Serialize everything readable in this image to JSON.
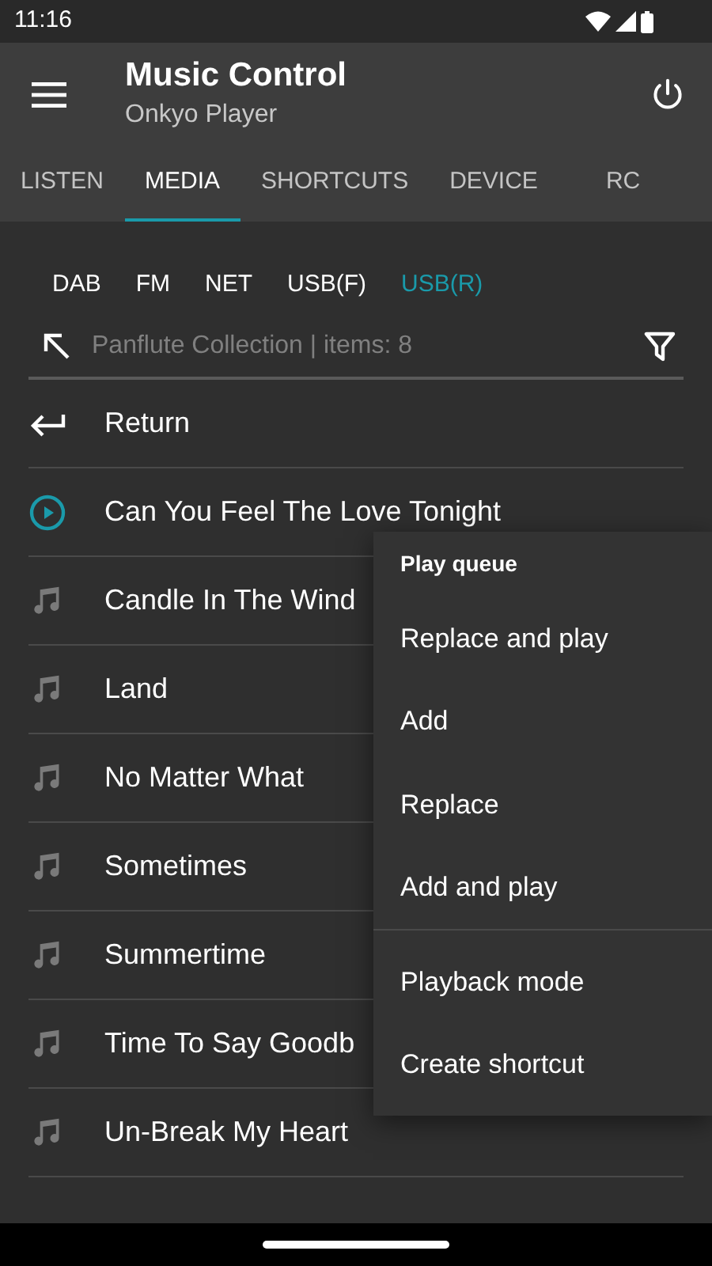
{
  "status_bar": {
    "time": "11:16"
  },
  "app_bar": {
    "title": "Music Control",
    "subtitle": "Onkyo Player"
  },
  "tabs": [
    {
      "label": "LISTEN",
      "selected": false
    },
    {
      "label": "MEDIA",
      "selected": true
    },
    {
      "label": "SHORTCUTS",
      "selected": false
    },
    {
      "label": "DEVICE",
      "selected": false
    },
    {
      "label": "RC",
      "selected": false
    }
  ],
  "sources": [
    {
      "label": "DAB",
      "selected": false
    },
    {
      "label": "FM",
      "selected": false
    },
    {
      "label": "NET",
      "selected": false
    },
    {
      "label": "USB(F)",
      "selected": false
    },
    {
      "label": "USB(R)",
      "selected": true
    }
  ],
  "path": {
    "text": "Panflute Collection | items: 8"
  },
  "items": [
    {
      "kind": "return",
      "label": "Return"
    },
    {
      "kind": "track",
      "label": "Can You Feel The Love Tonight",
      "playing": true
    },
    {
      "kind": "track",
      "label": "Candle In The Wind",
      "playing": false
    },
    {
      "kind": "track",
      "label": "Land",
      "playing": false
    },
    {
      "kind": "track",
      "label": "No Matter What",
      "playing": false
    },
    {
      "kind": "track",
      "label": "Sometimes",
      "playing": false
    },
    {
      "kind": "track",
      "label": "Summertime",
      "playing": false
    },
    {
      "kind": "track",
      "label": "Time To Say Goodb",
      "playing": false
    },
    {
      "kind": "track",
      "label": "Un-Break My Heart",
      "playing": false
    }
  ],
  "menu": {
    "header": "Play queue",
    "sections": [
      [
        "Replace and play",
        "Add",
        "Replace",
        "Add and play"
      ],
      [
        "Playback mode",
        "Create shortcut"
      ]
    ]
  }
}
